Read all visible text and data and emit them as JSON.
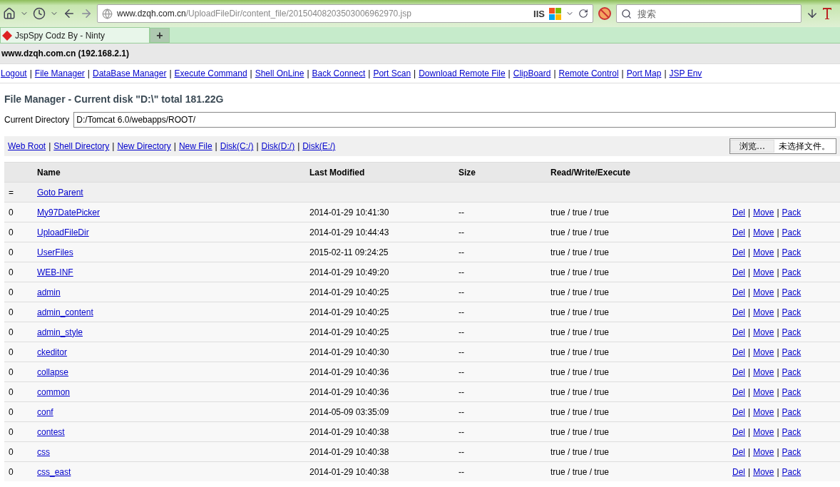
{
  "browser": {
    "address": {
      "host": "www.dzqh.com.cn",
      "path": "/UploadFileDir/content_file/20150408203503006962970.jsp"
    },
    "server_badge": "IIS",
    "search": {
      "placeholder": "搜索"
    },
    "tabs": [
      {
        "label": "JspSpy Codz By - Ninty",
        "selected": true
      }
    ],
    "new_tab": "+"
  },
  "separator": "|",
  "page": {
    "host": "www.dzqh.com.cn (192.168.2.1)",
    "nav": [
      "Logout",
      "File Manager",
      "DataBase Manager",
      "Execute Command",
      "Shell OnLine",
      "Back Connect",
      "Port Scan",
      "Download Remote File",
      "ClipBoard",
      "Remote Control",
      "Port Map",
      "JSP Env"
    ],
    "title": "File Manager - Current disk \"D:\\\" total 181.22G",
    "directory": {
      "label": "Current Directory",
      "value": "D:/Tomcat 6.0/webapps/ROOT/"
    },
    "links": [
      "Web Root",
      "Shell Directory",
      "New Directory",
      "New File",
      "Disk(C:/)",
      "Disk(D:/)",
      "Disk(E:/)"
    ],
    "upload": {
      "button": "浏览…",
      "status": "未选择文件。"
    },
    "table": {
      "columns": [
        "Name",
        "Last Modified",
        "Size",
        "Read/Write/Execute"
      ],
      "parent": {
        "mark": "=",
        "label": "Goto Parent"
      },
      "rows": [
        {
          "index": "0",
          "name": "My97DatePicker",
          "modified": "2014-01-29 10:41:30",
          "size": "--",
          "rwx": "true / true / true",
          "actions": [
            "Del",
            "Move",
            "Pack"
          ]
        },
        {
          "index": "0",
          "name": "UploadFileDir",
          "modified": "2014-01-29 10:44:43",
          "size": "--",
          "rwx": "true / true / true",
          "actions": [
            "Del",
            "Move",
            "Pack"
          ]
        },
        {
          "index": "0",
          "name": "UserFiles",
          "modified": "2015-02-11 09:24:25",
          "size": "--",
          "rwx": "true / true / true",
          "actions": [
            "Del",
            "Move",
            "Pack"
          ]
        },
        {
          "index": "0",
          "name": "WEB-INF",
          "modified": "2014-01-29 10:49:20",
          "size": "--",
          "rwx": "true / true / true",
          "actions": [
            "Del",
            "Move",
            "Pack"
          ]
        },
        {
          "index": "0",
          "name": "admin",
          "modified": "2014-01-29 10:40:25",
          "size": "--",
          "rwx": "true / true / true",
          "actions": [
            "Del",
            "Move",
            "Pack"
          ]
        },
        {
          "index": "0",
          "name": "admin_content",
          "modified": "2014-01-29 10:40:25",
          "size": "--",
          "rwx": "true / true / true",
          "actions": [
            "Del",
            "Move",
            "Pack"
          ]
        },
        {
          "index": "0",
          "name": "admin_style",
          "modified": "2014-01-29 10:40:25",
          "size": "--",
          "rwx": "true / true / true",
          "actions": [
            "Del",
            "Move",
            "Pack"
          ]
        },
        {
          "index": "0",
          "name": "ckeditor",
          "modified": "2014-01-29 10:40:30",
          "size": "--",
          "rwx": "true / true / true",
          "actions": [
            "Del",
            "Move",
            "Pack"
          ]
        },
        {
          "index": "0",
          "name": "collapse",
          "modified": "2014-01-29 10:40:36",
          "size": "--",
          "rwx": "true / true / true",
          "actions": [
            "Del",
            "Move",
            "Pack"
          ]
        },
        {
          "index": "0",
          "name": "common",
          "modified": "2014-01-29 10:40:36",
          "size": "--",
          "rwx": "true / true / true",
          "actions": [
            "Del",
            "Move",
            "Pack"
          ]
        },
        {
          "index": "0",
          "name": "conf",
          "modified": "2014-05-09 03:35:09",
          "size": "--",
          "rwx": "true / true / true",
          "actions": [
            "Del",
            "Move",
            "Pack"
          ]
        },
        {
          "index": "0",
          "name": "contest",
          "modified": "2014-01-29 10:40:38",
          "size": "--",
          "rwx": "true / true / true",
          "actions": [
            "Del",
            "Move",
            "Pack"
          ]
        },
        {
          "index": "0",
          "name": "css",
          "modified": "2014-01-29 10:40:38",
          "size": "--",
          "rwx": "true / true / true",
          "actions": [
            "Del",
            "Move",
            "Pack"
          ]
        },
        {
          "index": "0",
          "name": "css_east",
          "modified": "2014-01-29 10:40:38",
          "size": "--",
          "rwx": "true / true / true",
          "actions": [
            "Del",
            "Move",
            "Pack"
          ]
        }
      ]
    }
  }
}
